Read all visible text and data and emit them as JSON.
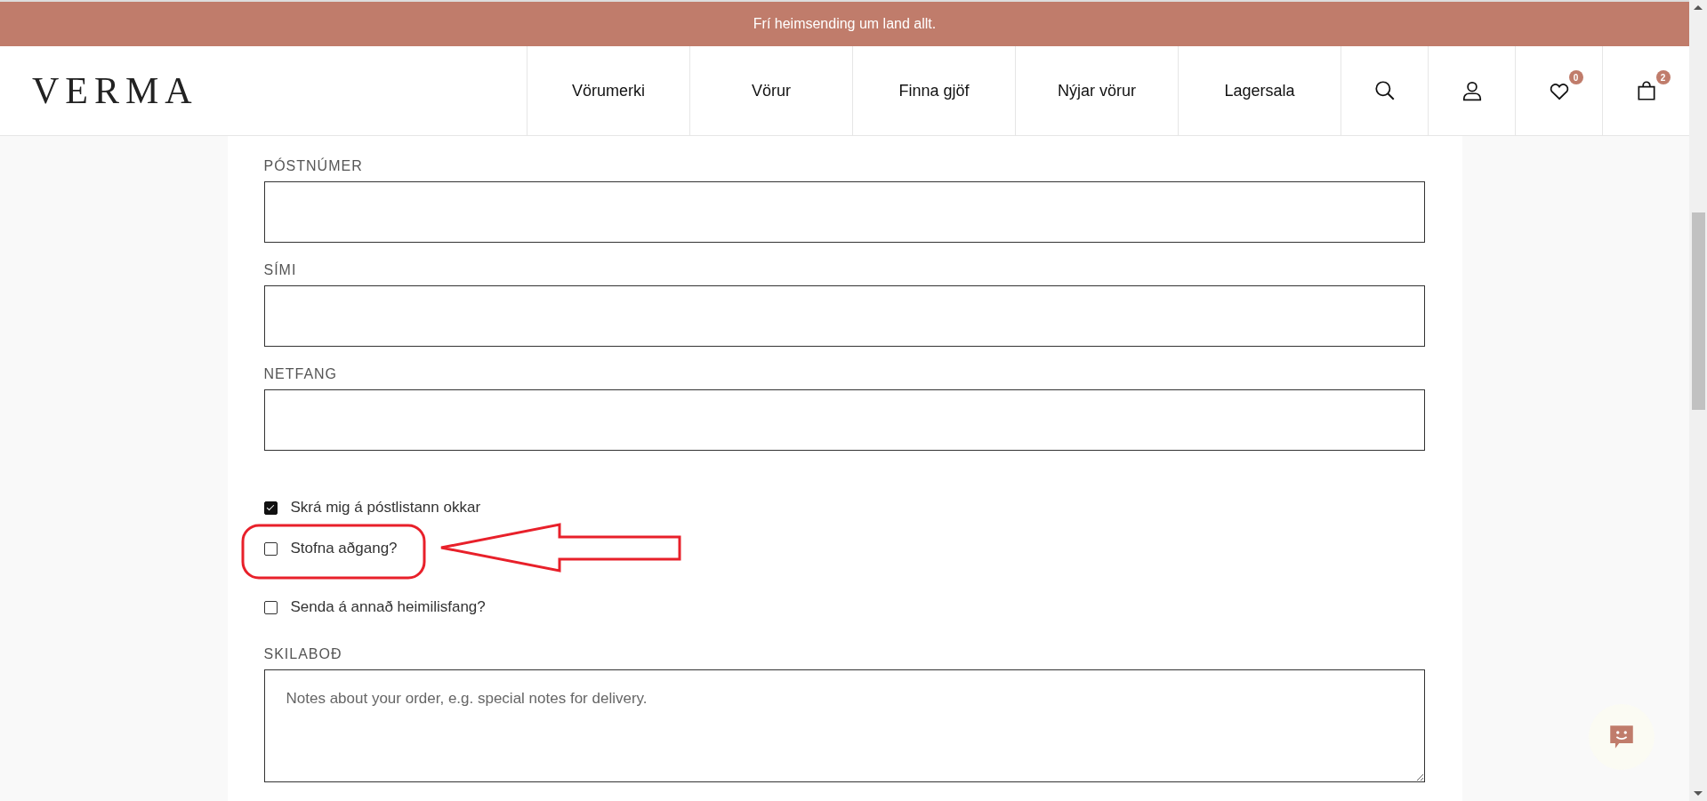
{
  "announcement": "Frí heimsending um land allt.",
  "logo": "VERMA",
  "nav": [
    {
      "label": "Vörumerki"
    },
    {
      "label": "Vörur"
    },
    {
      "label": "Finna gjöf"
    },
    {
      "label": "Nýjar vörur"
    },
    {
      "label": "Lagersala"
    }
  ],
  "header_icons": [
    {
      "kind": "search"
    },
    {
      "kind": "account"
    },
    {
      "kind": "wishlist",
      "badge": "0"
    },
    {
      "kind": "cart",
      "badge": "2"
    }
  ],
  "fields": [
    {
      "label": "PÓSTNÚMER",
      "kind": "input"
    },
    {
      "label": "SÍMI",
      "kind": "input"
    },
    {
      "label": "NETFANG",
      "kind": "input"
    }
  ],
  "checkboxes": [
    {
      "label": "Skrá mig á póstlistann okkar",
      "checked": true,
      "highlighted": false
    },
    {
      "label": "Stofna aðgang?",
      "checked": false,
      "highlighted": true
    },
    {
      "label": "Senda á annað heimilisfang?",
      "checked": false,
      "highlighted": false
    }
  ],
  "notes": {
    "label": "SKILABOÐ",
    "placeholder": "Notes about your order, e.g. special notes for delivery."
  }
}
